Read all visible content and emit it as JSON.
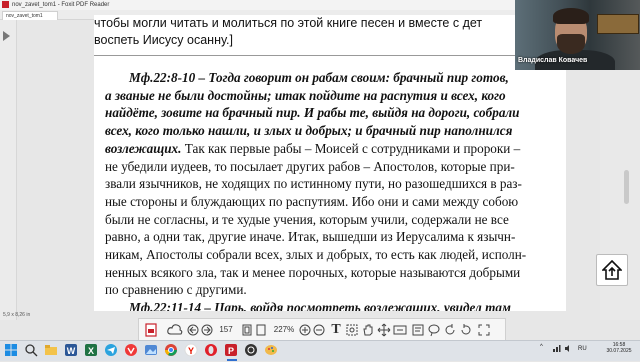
{
  "window": {
    "title": "nov_zavet_tom1 - Foxit PDF Reader",
    "tab_label": "nov_zavet_tom1"
  },
  "document": {
    "top_lines": [
      "чтобы могли читать и молиться по этой книге песен и вместе с дет",
      "воспеть Иисусу осанну.]"
    ],
    "body_lines": [
      {
        "bold": "Мф.22:8-10 – Тогда говорит он рабам своим: брачный пир готов,",
        "normal": "",
        "indent": true
      },
      {
        "bold": "а званые не были достойны; итак пойдите на распутия и всех, кого",
        "normal": "",
        "indent": false
      },
      {
        "bold": "найдёте, зовите на брачный пир. И рабы те, выйдя на дороги, собрали",
        "normal": "",
        "indent": false
      },
      {
        "bold": "всех, кого только нашли, и злых и добрых; и брачный пир наполнился",
        "normal": "",
        "indent": false
      },
      {
        "bold": "возлежащих.",
        "normal": " Так как первые рабы – Моисей с сотрудниками и пророки –",
        "indent": false
      },
      {
        "bold": "",
        "normal": "не убедили иудеев, то посылает других рабов – Апостолов, которые при-",
        "indent": false
      },
      {
        "bold": "",
        "normal": "звали язычников, не ходящих по истинному пути, но разошедшихся в раз-",
        "indent": false
      },
      {
        "bold": "",
        "normal": "ные стороны и блуждающих по распутиям. Ибо они и сами между собою",
        "indent": false
      },
      {
        "bold": "",
        "normal": "были не согласны, и те худые учения, которым учили, содержали не все",
        "indent": false
      },
      {
        "bold": "",
        "normal": "равно, а одни так, другие иначе. Итак, вышедши из Иерусалима к язычн-",
        "indent": false
      },
      {
        "bold": "",
        "normal": "никам, Апостолы собрали всех, злых и добрых, то есть как людей, исполн-",
        "indent": false
      },
      {
        "bold": "",
        "normal": "ненных всякого зла, так и менее порочных, которые называются добрыми",
        "indent": false
      },
      {
        "bold": "",
        "normal": "по сравнению с другими.",
        "indent": false
      },
      {
        "bold": "Мф.22:11-14 – Царь, войдя посмотреть возлежащих, увидел там",
        "normal": "",
        "indent": true
      }
    ],
    "page_size": "5,9 x 8,26 in"
  },
  "webcam": {
    "participant_name": "Владислав Ковачев"
  },
  "toolbar": {
    "page_number": "157",
    "zoom": "227%"
  },
  "tray": {
    "language": "RU",
    "time": "16:58",
    "date": "30.07.2025"
  },
  "colors": {
    "accent": "#2f6fd0",
    "pdf_red": "#c8202a"
  }
}
